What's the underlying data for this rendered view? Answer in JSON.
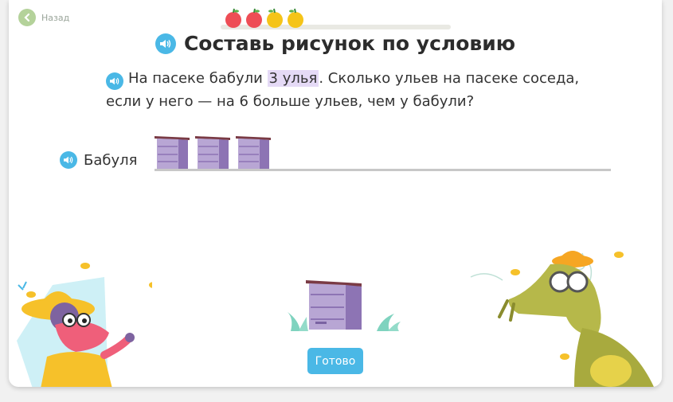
{
  "nav": {
    "back_label": "Назад"
  },
  "task": {
    "title": "Составь рисунок по условию",
    "condition_before": "На пасеке бабули ",
    "condition_highlight": "3 улья",
    "condition_after": ". Сколько ульев на пасеке соседа, если у него — на 6 больше ульев, чем у бабули?"
  },
  "row": {
    "label": "Бабуля",
    "hive_count": 3
  },
  "done_label": "Готово",
  "progress": {
    "fruits": [
      "apple",
      "apple",
      "lemon",
      "lemon"
    ]
  },
  "colors": {
    "accent": "#4ab8e6",
    "highlight": "#e5daf6",
    "hive": "#a792c6"
  }
}
